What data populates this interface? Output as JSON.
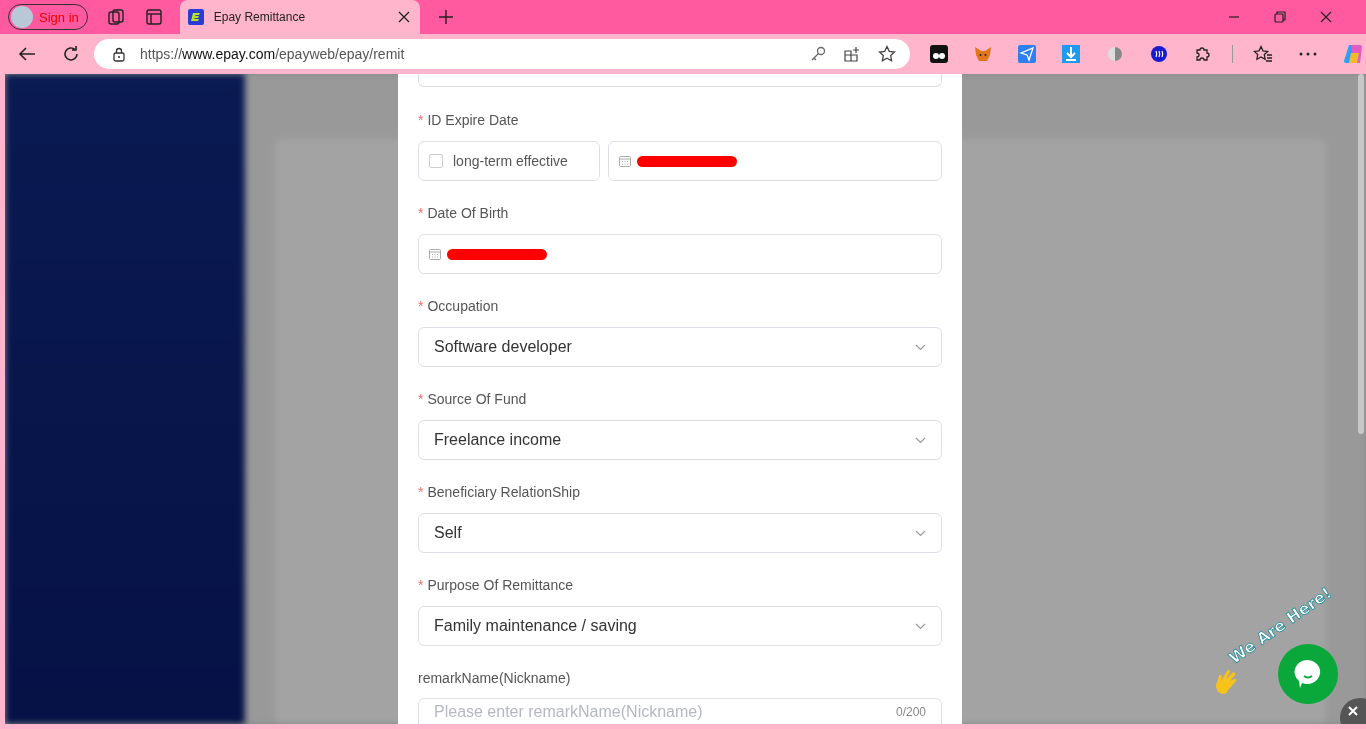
{
  "browser": {
    "profile": {
      "label": "Sign in"
    },
    "tabs": [
      {
        "title": "Epay Remittance",
        "selected": true
      }
    ],
    "address": "https://**www.epay.com**/epayweb/epay/remit"
  },
  "form": {
    "fields": [
      {
        "kind": "date-with-checkbox",
        "label": "ID Expire Date",
        "marker": "*",
        "checkbox": {
          "label": "long-term effective",
          "checked": false
        },
        "redacted": true
      },
      {
        "kind": "date",
        "label": "Date Of Birth",
        "marker": "*",
        "redacted": true
      },
      {
        "kind": "select",
        "label": "Occupation",
        "marker": "*",
        "value": "Software developer"
      },
      {
        "kind": "select",
        "label": "Source Of Fund",
        "marker": "*",
        "value": "Freelance income"
      },
      {
        "kind": "select",
        "label": "Beneficiary RelationShip",
        "marker": "*",
        "value": "Self"
      },
      {
        "kind": "select",
        "label": "Purpose Of Remittance",
        "marker": "*",
        "value": "Family maintenance / saving"
      },
      {
        "kind": "textarea",
        "label": "remarkName(Nickname)",
        "placeholder": "Please enter remarkName(Nickname)",
        "counter": "0/200"
      }
    ]
  },
  "chat_widget": {
    "badge": "We Are Here!"
  }
}
